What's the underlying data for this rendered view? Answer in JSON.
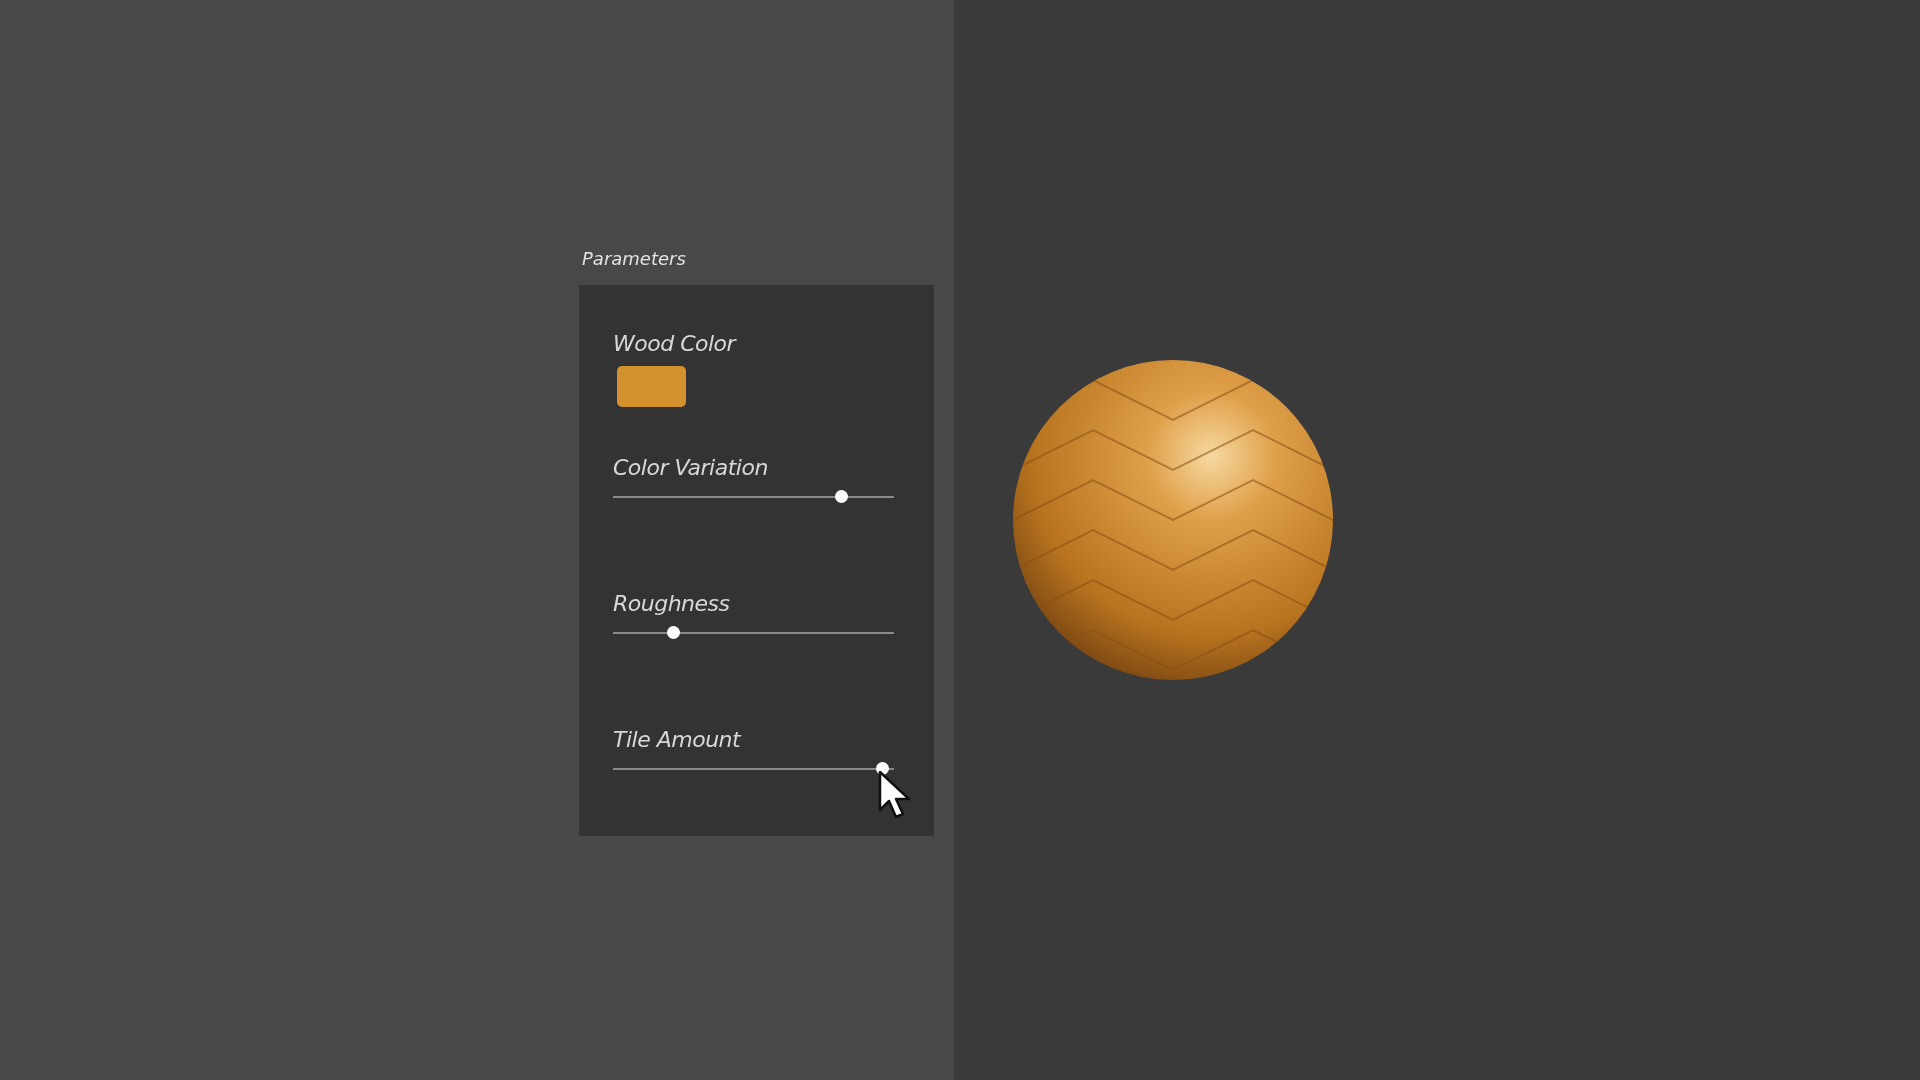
{
  "panel": {
    "title": "Parameters"
  },
  "parameters": [
    {
      "kind": "color",
      "label": "Wood Color",
      "color": "#d4922e"
    },
    {
      "kind": "slider",
      "label": "Color Variation",
      "level": 0.83
    },
    {
      "kind": "slider",
      "label": "Roughness",
      "level": 0.2
    },
    {
      "kind": "slider",
      "label": "Tile Amount",
      "level": 0.98,
      "hovered": true
    }
  ]
}
